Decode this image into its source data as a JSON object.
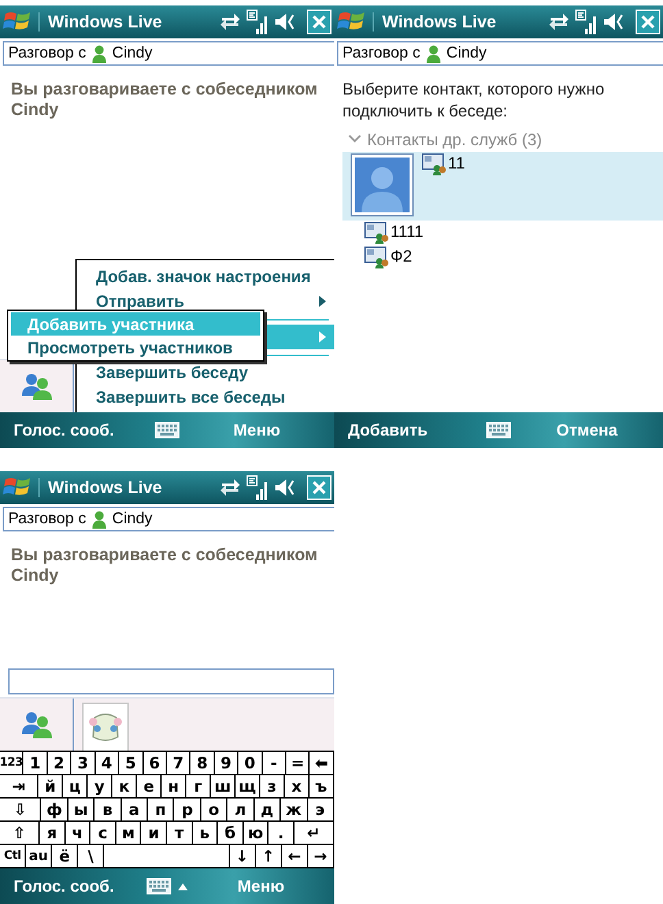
{
  "screens": [
    {
      "kind": "menu",
      "title": "Windows Live",
      "conversation": {
        "label": "Разговор с",
        "contact": "Cindy"
      },
      "message": "Вы разговариваете с собеседником Cindy",
      "tabs": [
        {
          "kind": "contacts",
          "selected": false
        }
      ],
      "menu": [
        {
          "kind": "item",
          "label": "Добав. значок настроения",
          "has_submenu": false,
          "selected": false
        },
        {
          "kind": "item",
          "label": "Отправить",
          "has_submenu": true,
          "selected": false
        },
        {
          "kind": "separator"
        },
        {
          "kind": "item",
          "has_submenu": true,
          "selected": true
        },
        {
          "kind": "separator"
        },
        {
          "kind": "item",
          "label": "Завершить беседу",
          "has_submenu": false,
          "selected": false
        },
        {
          "kind": "item",
          "label": "Завершить все беседы",
          "has_submenu": false,
          "selected": false
        }
      ],
      "submenu": [
        {
          "label": "Добавить участника",
          "selected": true
        },
        {
          "label": "Просмотреть участников",
          "selected": false
        }
      ],
      "softkeys": {
        "left": "Голос. сооб.",
        "right": "Меню",
        "input_panel_open": false
      }
    },
    {
      "kind": "picker",
      "title": "Windows Live",
      "conversation": {
        "label": "Разговор с",
        "contact": "Cindy"
      },
      "prompt": "Выберите контакт, которого нужно подключить к беседе:",
      "group": {
        "label": "Контакты др. служб (3)",
        "expanded": true,
        "contacts": [
          {
            "name": "11",
            "selected": true
          },
          {
            "name": "1111",
            "selected": false
          },
          {
            "name": "Ф2",
            "selected": false
          }
        ]
      },
      "softkeys": {
        "left": "Добавить",
        "right": "Отмена",
        "input_panel_open": false
      }
    },
    {
      "kind": "keyboard",
      "title": "Windows Live",
      "conversation": {
        "label": "Разговор с",
        "contact": "Cindy"
      },
      "message": "Вы разговариваете с собеседником Cindy",
      "tabs": [
        {
          "kind": "contacts",
          "selected": false
        },
        {
          "kind": "emoticon",
          "selected": true
        }
      ],
      "keyboard": [
        [
          {
            "kind": "char",
            "label": "123"
          },
          {
            "kind": "char",
            "label": "1"
          },
          {
            "kind": "char",
            "label": "2"
          },
          {
            "kind": "char",
            "label": "3"
          },
          {
            "kind": "char",
            "label": "4"
          },
          {
            "kind": "char",
            "label": "5"
          },
          {
            "kind": "char",
            "label": "6"
          },
          {
            "kind": "char",
            "label": "7"
          },
          {
            "kind": "char",
            "label": "8"
          },
          {
            "kind": "char",
            "label": "9"
          },
          {
            "kind": "char",
            "label": "0"
          },
          {
            "kind": "char",
            "label": "-"
          },
          {
            "kind": "char",
            "label": "="
          },
          {
            "kind": "char",
            "label": "⬅"
          }
        ],
        [
          {
            "kind": "func",
            "label": "⇥"
          },
          {
            "kind": "char",
            "label": "й"
          },
          {
            "kind": "char",
            "label": "ц"
          },
          {
            "kind": "char",
            "label": "у"
          },
          {
            "kind": "char",
            "label": "к"
          },
          {
            "kind": "char",
            "label": "е"
          },
          {
            "kind": "char",
            "label": "н"
          },
          {
            "kind": "char",
            "label": "г"
          },
          {
            "kind": "char",
            "label": "ш"
          },
          {
            "kind": "char",
            "label": "щ"
          },
          {
            "kind": "char",
            "label": "з"
          },
          {
            "kind": "char",
            "label": "х"
          },
          {
            "kind": "char",
            "label": "ъ"
          }
        ],
        [
          {
            "kind": "func",
            "label": "⇩"
          },
          {
            "kind": "char",
            "label": "ф"
          },
          {
            "kind": "char",
            "label": "ы"
          },
          {
            "kind": "char",
            "label": "в"
          },
          {
            "kind": "char",
            "label": "а"
          },
          {
            "kind": "char",
            "label": "п"
          },
          {
            "kind": "char",
            "label": "р"
          },
          {
            "kind": "char",
            "label": "о"
          },
          {
            "kind": "char",
            "label": "л"
          },
          {
            "kind": "char",
            "label": "д"
          },
          {
            "kind": "char",
            "label": "ж"
          },
          {
            "kind": "char",
            "label": "э"
          }
        ],
        [
          {
            "kind": "func",
            "label": "⇧"
          },
          {
            "kind": "char",
            "label": "я"
          },
          {
            "kind": "char",
            "label": "ч"
          },
          {
            "kind": "char",
            "label": "с"
          },
          {
            "kind": "char",
            "label": "м"
          },
          {
            "kind": "char",
            "label": "и"
          },
          {
            "kind": "char",
            "label": "т"
          },
          {
            "kind": "char",
            "label": "ь"
          },
          {
            "kind": "char",
            "label": "б"
          },
          {
            "kind": "char",
            "label": "ю"
          },
          {
            "kind": "char",
            "label": "."
          },
          {
            "kind": "func",
            "label": "↵"
          }
        ],
        [
          {
            "kind": "char",
            "label": "Ctl"
          },
          {
            "kind": "char",
            "label": "au"
          },
          {
            "kind": "char",
            "label": "ё"
          },
          {
            "kind": "char",
            "label": "\\"
          },
          {
            "kind": "space"
          },
          {
            "kind": "char",
            "label": "↓"
          },
          {
            "kind": "char",
            "label": "↑"
          },
          {
            "kind": "char",
            "label": "←"
          },
          {
            "kind": "char",
            "label": "→"
          }
        ]
      ],
      "softkeys": {
        "left": "Голос. сооб.",
        "right": "Меню",
        "input_panel_open": true
      }
    }
  ]
}
